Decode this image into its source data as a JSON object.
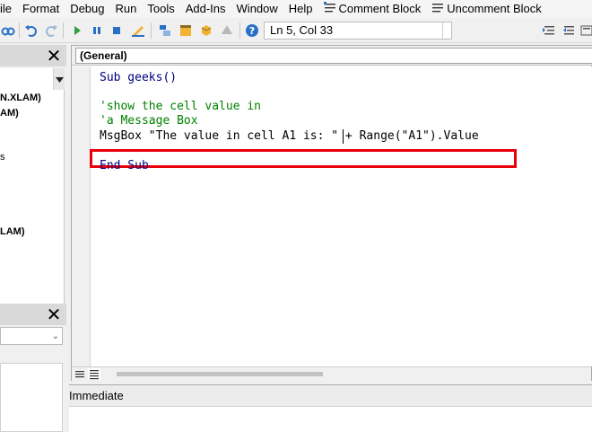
{
  "menu": {
    "items": [
      "File",
      "Format",
      "Debug",
      "Run",
      "Tools",
      "Add-Ins",
      "Window",
      "Help"
    ],
    "file_partial": "ile",
    "comment_block": "Comment Block",
    "uncomment_block": "Uncomment Block"
  },
  "toolbar": {
    "position": "Ln 5, Col 33"
  },
  "project": {
    "items": [
      "N.XLAM)",
      "AM)",
      "s",
      "LAM)"
    ]
  },
  "code": {
    "object_box": "(General)",
    "lines": [
      {
        "kind": "kw",
        "text": "Sub geeks()"
      },
      {
        "kind": "cmt",
        "text": "'show the cell value in"
      },
      {
        "kind": "cmt",
        "text": "'a Message Box"
      },
      {
        "kind": "plain",
        "text": "MsgBox \"The value in cell A1 is: \" + Range(\"A1\").Value"
      },
      {
        "kind": "kw",
        "text": "End Sub"
      }
    ],
    "highlight_color": "#e8000b",
    "keyword_color": "#00007f",
    "comment_color": "#008000"
  },
  "immediate": {
    "title": "Immediate"
  }
}
